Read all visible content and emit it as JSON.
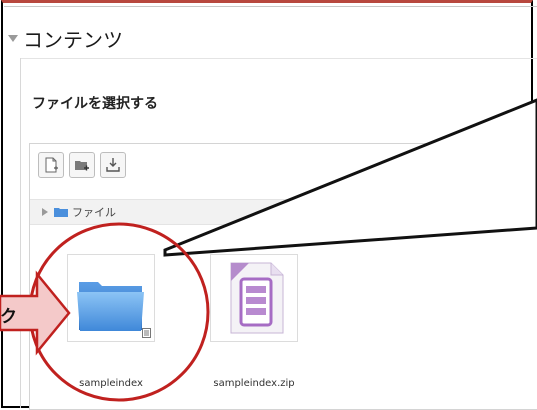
{
  "section": {
    "title": "コンテンツ"
  },
  "filepicker": {
    "label": "ファイルを選択する",
    "toolbar": {
      "new_file_icon": "new-file-icon",
      "new_folder_icon": "new-folder-icon",
      "download_icon": "download-icon"
    },
    "path": {
      "label": "ファイル"
    },
    "files": [
      {
        "name": "sampleindex",
        "type": "folder"
      },
      {
        "name": "sampleindex.zip",
        "type": "zip"
      }
    ]
  },
  "annotation": {
    "arrow_text": "ク"
  },
  "colors": {
    "accent_red": "#c0211f",
    "arrow_fill": "#f4c9c9",
    "folder_blue": "#4a8fdc"
  }
}
